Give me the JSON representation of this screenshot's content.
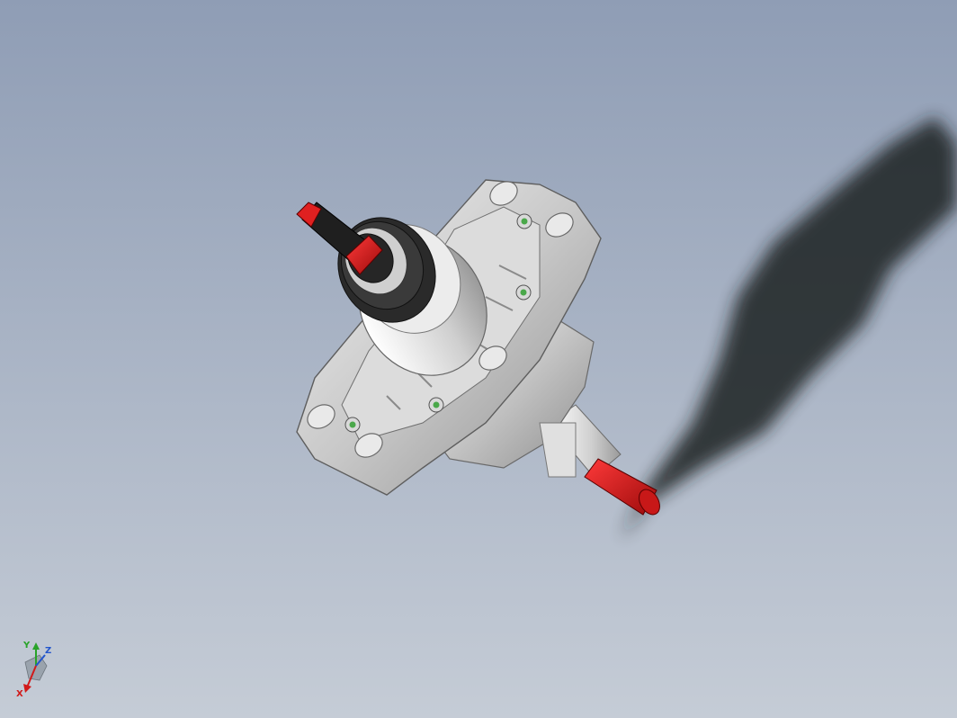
{
  "viewport": {
    "background_top": "#8f9db5",
    "background_bottom": "#c5ccd6"
  },
  "model": {
    "housing_color": "#d2d2d2",
    "shaft_color": "#222222",
    "accent_color": "#d11a1a",
    "fastener_color": "#4aa84a"
  },
  "triad": {
    "x_label": "X",
    "y_label": "Y",
    "z_label": "Z",
    "x_color": "#d11a1a",
    "y_color": "#29a329",
    "z_color": "#2255cc"
  }
}
